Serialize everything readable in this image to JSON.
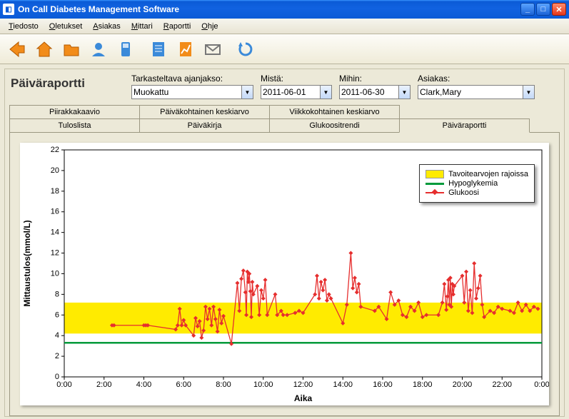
{
  "window": {
    "title": "On Call Diabetes Management Software"
  },
  "menu": {
    "items": [
      "Tiedosto",
      "Oletukset",
      "Asiakas",
      "Mittari",
      "Raportti",
      "Ohje"
    ]
  },
  "toolbar": {
    "icons": [
      "back",
      "home",
      "open",
      "patient",
      "device",
      "report",
      "graph",
      "mail",
      "refresh"
    ]
  },
  "header": {
    "report_title": "Päiväraportti",
    "period_label": "Tarkasteltava ajanjakso:",
    "period_value": "Muokattu",
    "from_label": "Mistä:",
    "from_value": "2011-06-01",
    "to_label": "Mihin:",
    "to_value": "2011-06-30",
    "client_label": "Asiakas:",
    "client_value": "Clark,Mary"
  },
  "tabs": {
    "row1": [
      "Piirakkakaavio",
      "Päiväkohtainen keskiarvo",
      "Viikkokohtainen keskiarvo"
    ],
    "row2": [
      "Tuloslista",
      "Päiväkirja",
      "Glukoositrendi",
      "Päiväraportti"
    ],
    "active": "Päiväraportti"
  },
  "legend": {
    "target": "Tavoitearvojen rajoissa",
    "hypo": "Hypoglykemia",
    "glucose": "Glukoosi"
  },
  "chart_data": {
    "type": "scatter",
    "xlabel": "Aika",
    "ylabel": "Mittaustulos(mmol/L)",
    "xticks": [
      "0:00",
      "2:00",
      "4:00",
      "6:00",
      "8:00",
      "10:00",
      "12:00",
      "14:00",
      "16:00",
      "18:00",
      "20:00",
      "22:00",
      "0:00"
    ],
    "yticks": [
      0,
      2,
      4,
      6,
      8,
      10,
      12,
      14,
      16,
      18,
      20,
      22
    ],
    "ylim": [
      0,
      22
    ],
    "target_band": {
      "low": 4.2,
      "high": 7.2
    },
    "hypo_line": 3.3,
    "series": [
      {
        "name": "Glukoosi",
        "color": "#e62e2e",
        "points": [
          [
            2.4,
            5.0
          ],
          [
            2.5,
            5.0
          ],
          [
            4.0,
            5.0
          ],
          [
            4.1,
            5.0
          ],
          [
            4.2,
            5.0
          ],
          [
            5.6,
            4.6
          ],
          [
            5.7,
            5.0
          ],
          [
            5.8,
            6.6
          ],
          [
            5.9,
            5.0
          ],
          [
            6.0,
            5.5
          ],
          [
            6.1,
            5.0
          ],
          [
            6.5,
            4.0
          ],
          [
            6.6,
            5.7
          ],
          [
            6.7,
            4.9
          ],
          [
            6.8,
            5.4
          ],
          [
            6.9,
            3.8
          ],
          [
            7.0,
            4.5
          ],
          [
            7.1,
            6.8
          ],
          [
            7.2,
            5.6
          ],
          [
            7.3,
            6.6
          ],
          [
            7.4,
            5.0
          ],
          [
            7.5,
            6.8
          ],
          [
            7.6,
            5.6
          ],
          [
            7.7,
            4.4
          ],
          [
            7.8,
            6.5
          ],
          [
            7.9,
            5.2
          ],
          [
            8.0,
            5.9
          ],
          [
            8.4,
            3.2
          ],
          [
            8.7,
            9.1
          ],
          [
            8.8,
            6.4
          ],
          [
            8.9,
            9.5
          ],
          [
            9.0,
            10.3
          ],
          [
            9.1,
            8.2
          ],
          [
            9.15,
            6.0
          ],
          [
            9.2,
            10.2
          ],
          [
            9.25,
            9.2
          ],
          [
            9.3,
            10.0
          ],
          [
            9.35,
            8.3
          ],
          [
            9.4,
            5.8
          ],
          [
            9.45,
            9.2
          ],
          [
            9.5,
            8.0
          ],
          [
            9.7,
            8.8
          ],
          [
            9.8,
            6.0
          ],
          [
            9.9,
            8.4
          ],
          [
            10.0,
            7.6
          ],
          [
            10.1,
            9.4
          ],
          [
            10.2,
            6.0
          ],
          [
            10.6,
            8.0
          ],
          [
            10.7,
            6.0
          ],
          [
            10.9,
            6.4
          ],
          [
            11.0,
            6.0
          ],
          [
            11.2,
            6.0
          ],
          [
            11.6,
            6.2
          ],
          [
            11.8,
            6.4
          ],
          [
            12.0,
            6.2
          ],
          [
            12.6,
            8.0
          ],
          [
            12.7,
            9.8
          ],
          [
            12.8,
            7.6
          ],
          [
            12.9,
            9.2
          ],
          [
            13.0,
            8.4
          ],
          [
            13.1,
            9.4
          ],
          [
            13.2,
            7.4
          ],
          [
            13.3,
            8.0
          ],
          [
            13.4,
            7.6
          ],
          [
            14.0,
            5.2
          ],
          [
            14.2,
            7.0
          ],
          [
            14.4,
            12.0
          ],
          [
            14.5,
            8.6
          ],
          [
            14.6,
            9.6
          ],
          [
            14.7,
            8.2
          ],
          [
            14.8,
            9.0
          ],
          [
            14.9,
            6.8
          ],
          [
            15.6,
            6.4
          ],
          [
            15.8,
            6.8
          ],
          [
            16.2,
            5.6
          ],
          [
            16.4,
            8.2
          ],
          [
            16.6,
            7.0
          ],
          [
            16.8,
            7.4
          ],
          [
            17.0,
            6.0
          ],
          [
            17.2,
            5.8
          ],
          [
            17.4,
            6.8
          ],
          [
            17.6,
            6.4
          ],
          [
            17.8,
            7.2
          ],
          [
            18.0,
            5.8
          ],
          [
            18.2,
            6.0
          ],
          [
            18.8,
            6.0
          ],
          [
            19.0,
            7.2
          ],
          [
            19.1,
            9.0
          ],
          [
            19.2,
            6.5
          ],
          [
            19.25,
            7.8
          ],
          [
            19.3,
            9.4
          ],
          [
            19.35,
            7.0
          ],
          [
            19.4,
            9.6
          ],
          [
            19.45,
            6.8
          ],
          [
            19.5,
            9.0
          ],
          [
            19.55,
            8.0
          ],
          [
            19.6,
            8.8
          ],
          [
            20.0,
            9.8
          ],
          [
            20.1,
            7.2
          ],
          [
            20.2,
            10.2
          ],
          [
            20.3,
            6.4
          ],
          [
            20.4,
            8.4
          ],
          [
            20.5,
            6.2
          ],
          [
            20.6,
            11.0
          ],
          [
            20.7,
            7.6
          ],
          [
            20.8,
            8.6
          ],
          [
            20.9,
            9.8
          ],
          [
            21.0,
            7.0
          ],
          [
            21.1,
            5.8
          ],
          [
            21.4,
            6.4
          ],
          [
            21.6,
            6.2
          ],
          [
            21.8,
            6.8
          ],
          [
            22.0,
            6.6
          ],
          [
            22.4,
            6.4
          ],
          [
            22.6,
            6.2
          ],
          [
            22.8,
            7.2
          ],
          [
            23.0,
            6.4
          ],
          [
            23.2,
            7.0
          ],
          [
            23.4,
            6.4
          ],
          [
            23.6,
            6.8
          ],
          [
            23.8,
            6.6
          ]
        ]
      }
    ]
  }
}
